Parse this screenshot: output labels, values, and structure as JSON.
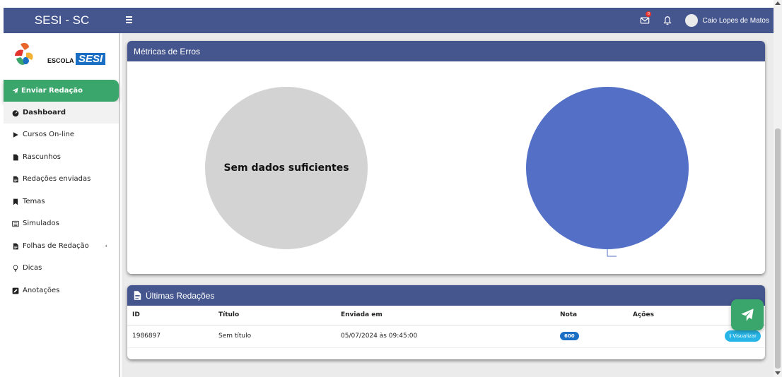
{
  "navbar": {
    "brand": "SESI - SC",
    "notification_count": "0",
    "user_name": "Caio Lopes de Matos"
  },
  "sidebar": {
    "logo_word": "ESCOLA",
    "logo_brand": "SESI",
    "send_button": "Enviar Redação",
    "items": [
      {
        "label": "Dashboard",
        "icon": "dashboard-icon"
      },
      {
        "label": "Cursos On-line",
        "icon": "play-icon"
      },
      {
        "label": "Rascunhos",
        "icon": "file-icon"
      },
      {
        "label": "Redações enviadas",
        "icon": "file-text-icon"
      },
      {
        "label": "Temas",
        "icon": "bookmark-icon"
      },
      {
        "label": "Simulados",
        "icon": "list-icon"
      },
      {
        "label": "Folhas de Redação",
        "icon": "file-text-icon"
      },
      {
        "label": "Dicas",
        "icon": "lightbulb-icon"
      },
      {
        "label": "Anotações",
        "icon": "pencil-icon"
      }
    ]
  },
  "metrics_card": {
    "title": "Métricas de Erros",
    "empty_chart_text": "Sem dados suficientes"
  },
  "recent_card": {
    "title": "Últimas Redações",
    "columns": [
      "ID",
      "Título",
      "Enviada em",
      "Nota",
      "Ações"
    ],
    "rows": [
      {
        "id": "1986897",
        "title": "Sem título",
        "sent_at": "05/07/2024 às 09:45:00",
        "grade": "600",
        "action": "Visualizar"
      }
    ]
  },
  "colors": {
    "header": "#45568f",
    "accent_green": "#3aa66b",
    "pie_blue": "#5370c6",
    "badge_blue": "#1a6fc4",
    "button_cyan": "#26b5e6"
  }
}
